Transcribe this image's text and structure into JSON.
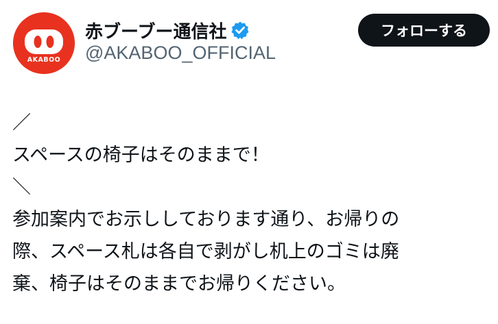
{
  "author": {
    "avatar_caption": "AKABOO",
    "avatar_icon": "pig-nose-logo",
    "display_name": "赤ブーブー通信社",
    "verified_icon": "verified-badge-icon",
    "handle": "@AKABOO_OFFICIAL"
  },
  "follow_button": {
    "label": "フォローする"
  },
  "tweet": {
    "lines": [
      "／",
      "スペースの椅子はそのままで！",
      "＼",
      "参加案内でお示ししております通り、お帰りの",
      "際、スペース札は各自で剥がし机上のゴミは廃",
      "棄、椅子はそのままでお帰りください。"
    ]
  },
  "colors": {
    "brand_red": "#e8321f",
    "verified_blue": "#1d9bf0",
    "text_primary": "#0f1419",
    "text_secondary": "#536471",
    "button_bg": "#0f1419"
  }
}
